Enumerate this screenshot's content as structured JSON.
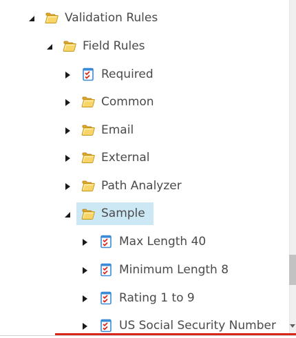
{
  "tree": {
    "validation_rules": {
      "label": "Validation Rules",
      "icon": "folder-icon",
      "expanded": true
    },
    "field_rules": {
      "label": "Field Rules",
      "icon": "folder-icon",
      "expanded": true
    },
    "children": [
      {
        "label": "Required",
        "icon": "checklist-icon"
      },
      {
        "label": "Common",
        "icon": "folder-icon"
      },
      {
        "label": "Email",
        "icon": "folder-icon"
      },
      {
        "label": "External",
        "icon": "folder-icon"
      },
      {
        "label": "Path Analyzer",
        "icon": "folder-icon"
      }
    ],
    "sample": {
      "label": "Sample",
      "icon": "folder-icon",
      "expanded": true,
      "selected": true,
      "items": [
        {
          "label": "Max Length 40",
          "icon": "checklist-icon"
        },
        {
          "label": "Minimum Length 8",
          "icon": "checklist-icon"
        },
        {
          "label": "Rating 1 to 9",
          "icon": "checklist-icon"
        },
        {
          "label": "US Social Security Number",
          "icon": "checklist-icon"
        }
      ]
    }
  },
  "colors": {
    "selection": "#cde8f5",
    "folder": "#f2c84b",
    "checklist_border": "#3b8ad6",
    "checklist_mark": "#d9261c",
    "bottom_accent": "#d9261c"
  }
}
